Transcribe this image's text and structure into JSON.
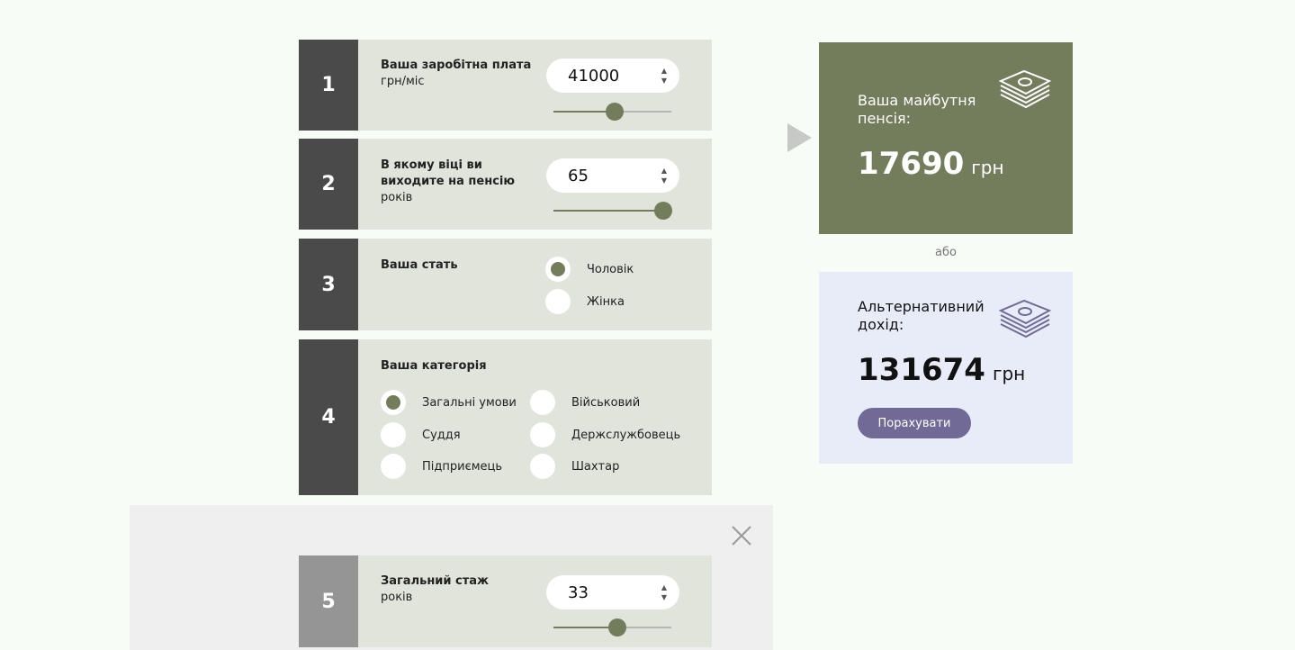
{
  "steps": [
    {
      "number": "1",
      "title": "Ваша заробітна плата",
      "unit": "грн/міс",
      "value": "41000",
      "slider_fraction": 0.52
    },
    {
      "number": "2",
      "title": "В якому віці ви виходите на пенсію",
      "unit": "років",
      "value": "65",
      "slider_fraction": 0.93
    },
    {
      "number": "3",
      "title": "Ваша стать",
      "options": [
        {
          "label": "Чоловік",
          "selected": true
        },
        {
          "label": "Жінка",
          "selected": false
        }
      ]
    },
    {
      "number": "4",
      "title": "Ваша категорія",
      "options": [
        {
          "label": "Загальні умови",
          "selected": true
        },
        {
          "label": "Військовий",
          "selected": false
        },
        {
          "label": "Суддя",
          "selected": false
        },
        {
          "label": "Держслужбовець",
          "selected": false
        },
        {
          "label": "Підприємець",
          "selected": false
        },
        {
          "label": "Шахтар",
          "selected": false
        }
      ]
    },
    {
      "number": "5",
      "title": "Загальний стаж",
      "unit": "років",
      "value": "33",
      "slider_fraction": 0.54
    }
  ],
  "spinner": {
    "up": "▲",
    "down": "▼"
  },
  "result": {
    "label": "Ваша майбутня пенсія:",
    "amount": "17690",
    "currency": "грн",
    "icon": "money-stack-icon"
  },
  "or_text": "або",
  "alternative": {
    "label": "Альтернативний дохід:",
    "amount": "131674",
    "currency": "грн",
    "button": "Порахувати",
    "icon": "money-stack-icon"
  },
  "colors": {
    "accent": "#737d5c",
    "step_bg": "#e1e4db",
    "number_bg": "#4a4a4a",
    "alt_bg": "#e8ecf8",
    "button": "#716a96"
  }
}
